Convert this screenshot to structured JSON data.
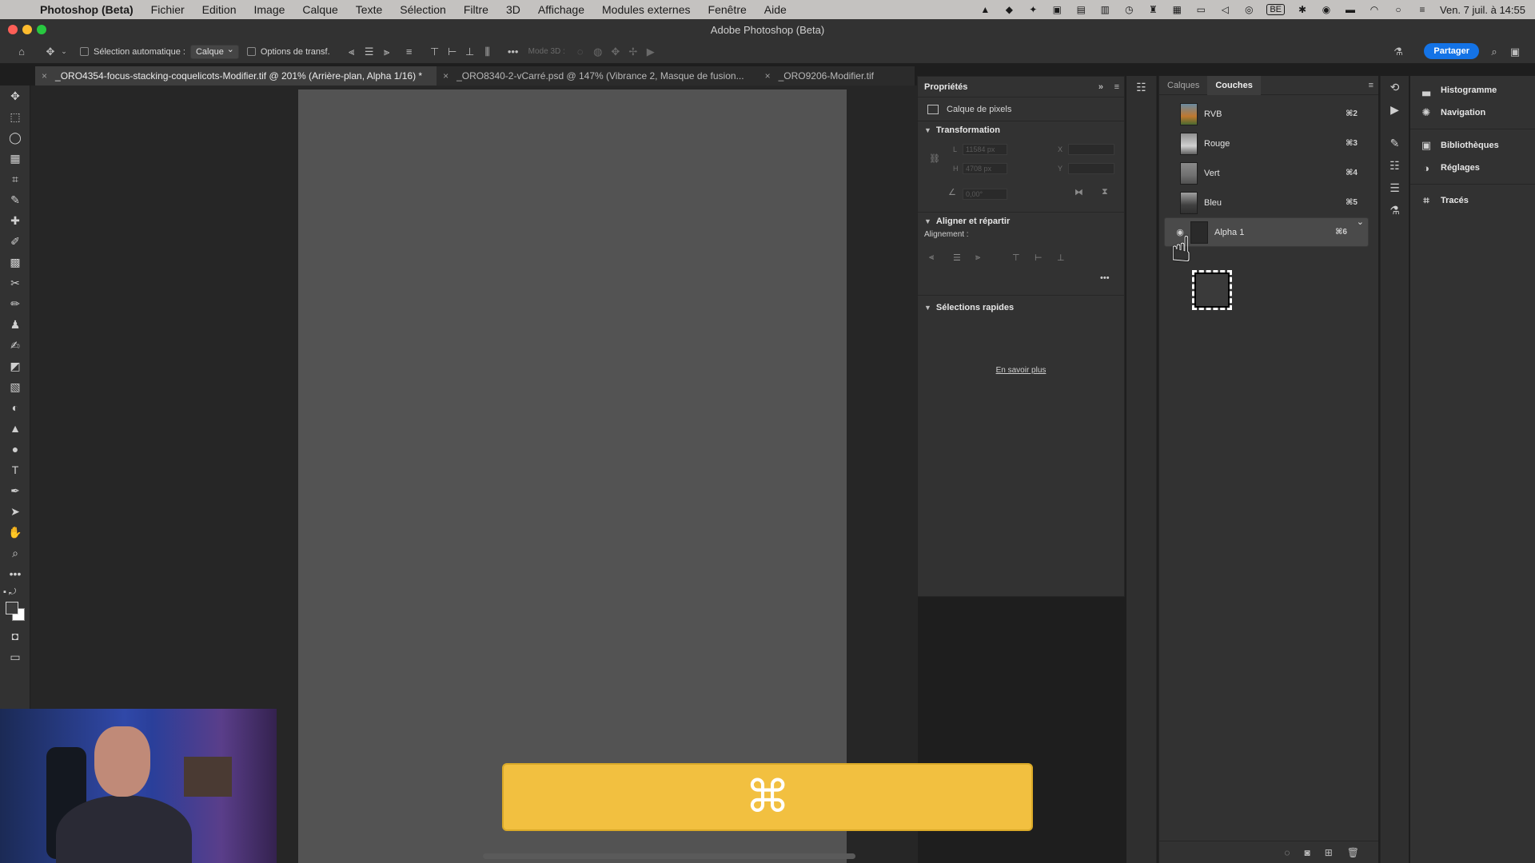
{
  "menubar": {
    "app": "Photoshop (Beta)",
    "items": [
      "Fichier",
      "Edition",
      "Image",
      "Calque",
      "Texte",
      "Sélection",
      "Filtre",
      "3D",
      "Affichage",
      "Modules externes",
      "Fenêtre",
      "Aide"
    ],
    "keyboard_layout": "BE",
    "datetime": "Ven. 7 juil. à 14:55"
  },
  "window": {
    "title": "Adobe Photoshop (Beta)"
  },
  "options": {
    "auto_select_label": "Sélection automatique :",
    "auto_select_value": "Calque",
    "transform_label": "Options de transf.",
    "mode3d_label": "Mode 3D :",
    "share_label": "Partager"
  },
  "tabs": [
    {
      "label": "_ORO4354-focus-stacking-coquelicots-Modifier.tif @ 201% (Arrière-plan, Alpha 1/16) *",
      "active": true
    },
    {
      "label": "_ORO8340-2-vCarré.psd @ 147% (Vibrance 2, Masque de fusion...",
      "active": false
    },
    {
      "label": "_ORO9206-Modifier.tif",
      "active": false
    }
  ],
  "properties": {
    "title": "Propriétés",
    "layer_type": "Calque de pixels",
    "transform_title": "Transformation",
    "width_label": "L",
    "width_value": "11584 px",
    "height_label": "H",
    "height_value": "4708 px",
    "x_label": "X",
    "y_label": "Y",
    "angle_value": "0,00°",
    "align_title": "Aligner et répartir",
    "align_label": "Alignement :",
    "quick_title": "Sélections rapides",
    "learn_more": "En savoir plus"
  },
  "channels": {
    "tabs": [
      {
        "label": "Calques",
        "active": false
      },
      {
        "label": "Couches",
        "active": true
      }
    ],
    "rows": [
      {
        "name": "RVB",
        "shortcut": "⌘2",
        "visible": false,
        "selected": false
      },
      {
        "name": "Rouge",
        "shortcut": "⌘3",
        "visible": false,
        "selected": false
      },
      {
        "name": "Vert",
        "shortcut": "⌘4",
        "visible": false,
        "selected": false
      },
      {
        "name": "Bleu",
        "shortcut": "⌘5",
        "visible": false,
        "selected": false
      },
      {
        "name": "Alpha 1",
        "shortcut": "⌘6",
        "visible": true,
        "selected": true
      }
    ]
  },
  "right_panels": [
    {
      "label": "Histogramme",
      "icon": "histogram-icon"
    },
    {
      "label": "Navigation",
      "icon": "navigator-icon"
    },
    {
      "label": "Bibliothèques",
      "icon": "libraries-icon"
    },
    {
      "label": "Réglages",
      "icon": "adjustments-icon"
    },
    {
      "label": "Tracés",
      "icon": "paths-icon"
    }
  ],
  "key_overlay": {
    "key": "⌘"
  },
  "colors": {
    "accent": "#1473e6",
    "key_overlay_bg": "#f2c040"
  }
}
